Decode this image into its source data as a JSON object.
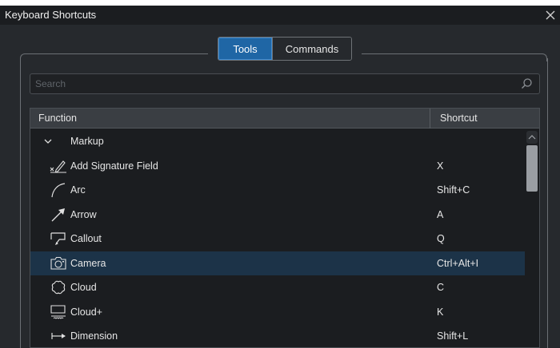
{
  "window": {
    "title": "Keyboard Shortcuts"
  },
  "tabs": [
    {
      "label": "Tools",
      "active": true
    },
    {
      "label": "Commands",
      "active": false
    }
  ],
  "search": {
    "placeholder": "Search",
    "value": ""
  },
  "table": {
    "headers": {
      "function": "Function",
      "shortcut": "Shortcut"
    },
    "group": {
      "label": "Markup",
      "expanded": true
    },
    "rows": [
      {
        "label": "Add Signature Field",
        "shortcut": "X",
        "icon": "signature-icon"
      },
      {
        "label": "Arc",
        "shortcut": "Shift+C",
        "icon": "arc-icon"
      },
      {
        "label": "Arrow",
        "shortcut": "A",
        "icon": "arrow-icon"
      },
      {
        "label": "Callout",
        "shortcut": "Q",
        "icon": "callout-icon"
      },
      {
        "label": "Camera",
        "shortcut": "Ctrl+Alt+I",
        "icon": "camera-icon",
        "selected": true
      },
      {
        "label": "Cloud",
        "shortcut": "C",
        "icon": "cloud-icon"
      },
      {
        "label": "Cloud+",
        "shortcut": "K",
        "icon": "cloud-plus-icon"
      },
      {
        "label": "Dimension",
        "shortcut": "Shift+L",
        "icon": "dimension-icon"
      }
    ]
  },
  "colors": {
    "background": "#26292d",
    "selected_row": "#1c3348",
    "active_tab": "#1f66a5",
    "titlebar": "#1b1d20"
  }
}
